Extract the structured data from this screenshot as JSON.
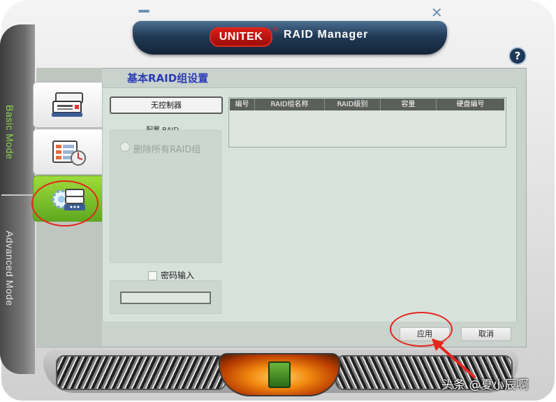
{
  "window": {
    "brand": "UNITEK",
    "registered_mark": "®",
    "title": "RAID Manager",
    "minimize_icon": "minimize-icon",
    "close_icon": "close-x-icon",
    "help": "?"
  },
  "modes": {
    "basic": "Basic Mode",
    "advanced": "Advanced Mode"
  },
  "sidebar": {
    "tabs": [
      {
        "icon": "disk-stack-icon"
      },
      {
        "icon": "disk-settings-icon"
      },
      {
        "icon": "gear-raid-icon",
        "active": true
      }
    ]
  },
  "main": {
    "section_title": "基本RAID组设置",
    "controller_button": "无控制器",
    "config_label": "配置 RAID",
    "delete_all_option": "删除所有RAID组",
    "password_label": "密码输入",
    "password_value": ""
  },
  "table": {
    "columns": [
      "编号",
      "RAID组名称",
      "RAID级别",
      "容量",
      "硬盘编号"
    ],
    "rows": []
  },
  "footer": {
    "apply": "应用",
    "cancel": "取消"
  },
  "watermark": "头条 @夏小辰啊",
  "colors": {
    "accent_green": "#8fd64a",
    "title_blue": "#2a3ab8",
    "highlight_red": "#e4261e",
    "header_navy": "#213a56"
  }
}
